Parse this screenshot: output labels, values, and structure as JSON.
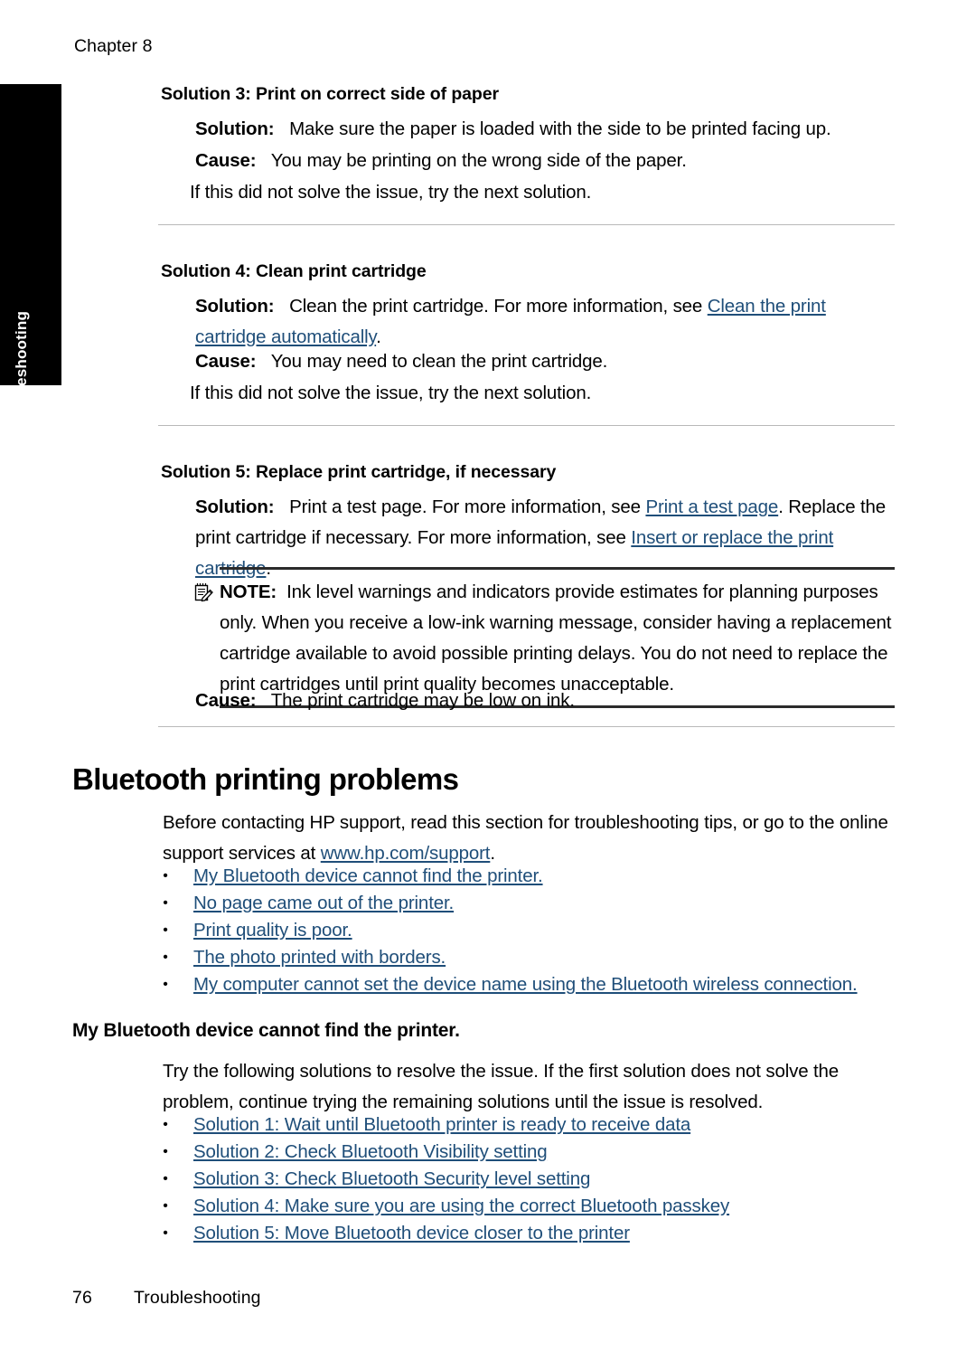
{
  "page": {
    "chapter_header": "Chapter 8",
    "side_tab_label": "Troubleshooting",
    "footer_page_number": "76",
    "footer_section": "Troubleshooting",
    "link_color": "#1f4e79"
  },
  "solution3": {
    "heading": "Solution 3: Print on correct side of paper",
    "solution_label": "Solution:",
    "solution_text": "Make sure the paper is loaded with the side to be printed facing up.",
    "cause_label": "Cause:",
    "cause_text": "You may be printing on the wrong side of the paper.",
    "next_text": "If this did not solve the issue, try the next solution."
  },
  "solution4": {
    "heading": "Solution 4: Clean print cartridge",
    "solution_label": "Solution:",
    "solution_text_a": "Clean the print cartridge. For more information, see ",
    "solution_link": "Clean the print cartridge automatically",
    "solution_text_b": ".",
    "cause_label": "Cause:",
    "cause_text": "You may need to clean the print cartridge.",
    "next_text": "If this did not solve the issue, try the next solution."
  },
  "solution5": {
    "heading": "Solution 5: Replace print cartridge, if necessary",
    "solution_label": "Solution:",
    "solution_text_a": "Print a test page. For more information, see ",
    "solution_link_1": "Print a test page",
    "solution_text_b": ". Replace the print cartridge if necessary. For more information, see ",
    "solution_link_2": "Insert or replace the print cartridge",
    "solution_text_c": ".",
    "note_label": "NOTE:",
    "note_text": "Ink level warnings and indicators provide estimates for planning purposes only. When you receive a low-ink warning message, consider having a replacement cartridge available to avoid possible printing delays. You do not need to replace the print cartridges until print quality becomes unacceptable.",
    "note_icon": "note-pencil-icon",
    "cause_label": "Cause:",
    "cause_text": "The print cartridge may be low on ink."
  },
  "bluetooth_section": {
    "title": "Bluetooth printing problems",
    "intro_a": "Before contacting HP support, read this section for troubleshooting tips, or go to the online support services at ",
    "intro_link": "www.hp.com/support",
    "intro_b": ".",
    "bullet": "•",
    "links": [
      "My Bluetooth device cannot find the printer.",
      "No page came out of the printer.",
      "Print quality is poor.",
      "The photo printed with borders.",
      "My computer cannot set the device name using the Bluetooth wireless connection."
    ]
  },
  "cannot_find_printer": {
    "title": "My Bluetooth device cannot find the printer.",
    "intro": "Try the following solutions to resolve the issue. If the first solution does not solve the problem, continue trying the remaining solutions until the issue is resolved.",
    "bullet": "•",
    "links": [
      "Solution 1: Wait until Bluetooth printer is ready to receive data",
      "Solution 2: Check Bluetooth Visibility setting",
      "Solution 3: Check Bluetooth Security level setting",
      "Solution 4: Make sure you are using the correct Bluetooth passkey",
      "Solution 5: Move Bluetooth device closer to the printer"
    ]
  }
}
